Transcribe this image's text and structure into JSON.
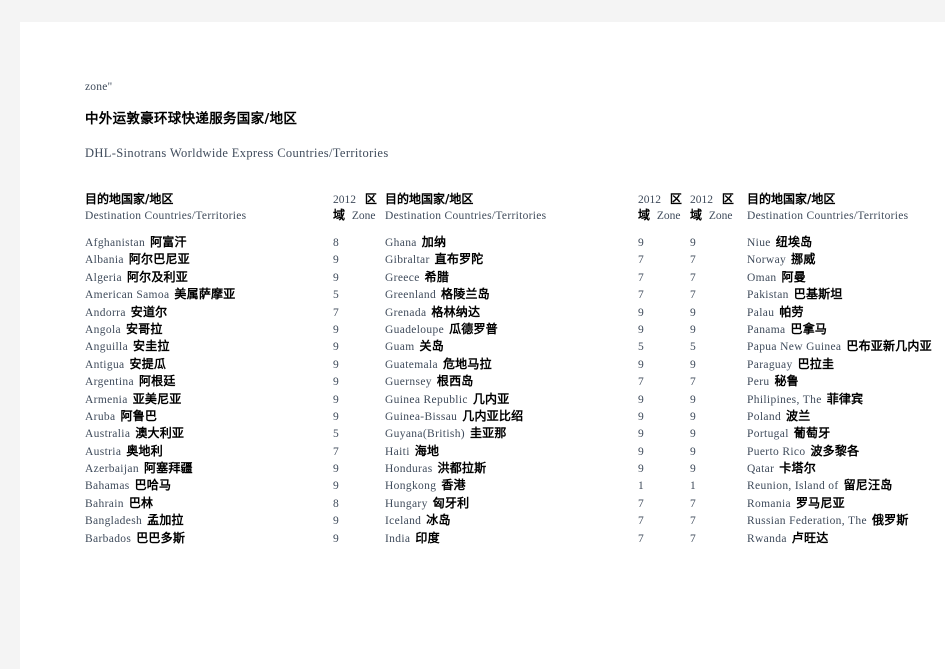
{
  "page": {
    "fragment_text": "zone\"",
    "title_cn": "中外运敦豪环球快递服务国家/地区",
    "title_en": "DHL-Sinotrans Worldwide Express Countries/Territories"
  },
  "colors": {
    "english_text": "#3f4b5b",
    "chinese_text": "#000000",
    "page_background": "#ffffff",
    "gutter": "#f4f4f4"
  },
  "header": {
    "destination_cn": "目的地国家/地区",
    "destination_en": "Destination Countries/Territories",
    "zone_year": "2012",
    "zone_cn_1": "区",
    "zone_cn_2": "域",
    "zone_en": "Zone"
  },
  "columns": [
    {
      "id": "column-1",
      "zone_position": "right",
      "rows": [
        {
          "en": "Afghanistan",
          "cn": "阿富汗",
          "zone": "8"
        },
        {
          "en": "Albania",
          "cn": "阿尔巴尼亚",
          "zone": "9"
        },
        {
          "en": "Algeria",
          "cn": "阿尔及利亚",
          "zone": "9"
        },
        {
          "en": "American Samoa",
          "cn": "美属萨摩亚",
          "zone": "5"
        },
        {
          "en": "Andorra",
          "cn": "安道尔",
          "zone": "7"
        },
        {
          "en": "Angola",
          "cn": "安哥拉",
          "zone": "9"
        },
        {
          "en": "Anguilla",
          "cn": "安圭拉",
          "zone": "9"
        },
        {
          "en": "Antigua",
          "cn": "安提瓜",
          "zone": "9"
        },
        {
          "en": "Argentina",
          "cn": "阿根廷",
          "zone": "9"
        },
        {
          "en": "Armenia",
          "cn": "亚美尼亚",
          "zone": "9"
        },
        {
          "en": "Aruba",
          "cn": "阿鲁巴",
          "zone": "9"
        },
        {
          "en": "Australia",
          "cn": "澳大利亚",
          "zone": "5"
        },
        {
          "en": "Austria",
          "cn": "奥地利",
          "zone": "7"
        },
        {
          "en": "Azerbaijan",
          "cn": "阿塞拜疆",
          "zone": "9"
        },
        {
          "en": "Bahamas",
          "cn": "巴哈马",
          "zone": "9"
        },
        {
          "en": "Bahrain",
          "cn": "巴林",
          "zone": "8"
        },
        {
          "en": "Bangladesh",
          "cn": "孟加拉",
          "zone": "9"
        },
        {
          "en": "Barbados",
          "cn": "巴巴多斯",
          "zone": "9"
        }
      ]
    },
    {
      "id": "column-2",
      "zone_position": "right",
      "rows": [
        {
          "en": "Ghana",
          "cn": "加纳",
          "zone": "9"
        },
        {
          "en": "Gibraltar",
          "cn": "直布罗陀",
          "zone": "7"
        },
        {
          "en": "Greece",
          "cn": "希腊",
          "zone": "7"
        },
        {
          "en": "Greenland",
          "cn": "格陵兰岛",
          "zone": "7"
        },
        {
          "en": "Grenada",
          "cn": "格林纳达",
          "zone": "9"
        },
        {
          "en": "Guadeloupe",
          "cn": "瓜德罗普",
          "zone": "9"
        },
        {
          "en": "Guam",
          "cn": "关岛",
          "zone": "5"
        },
        {
          "en": "Guatemala",
          "cn": "危地马拉",
          "zone": "9"
        },
        {
          "en": "Guernsey",
          "cn": "根西岛",
          "zone": "7"
        },
        {
          "en": "Guinea Republic",
          "cn": "几内亚",
          "zone": "9"
        },
        {
          "en": "Guinea-Bissau",
          "cn": "几内亚比绍",
          "zone": "9"
        },
        {
          "en": "Guyana(British)",
          "cn": "圭亚那",
          "zone": "9"
        },
        {
          "en": "Haiti",
          "cn": "海地",
          "zone": "9"
        },
        {
          "en": "Honduras",
          "cn": "洪都拉斯",
          "zone": "9"
        },
        {
          "en": "Hongkong",
          "cn": "香港",
          "zone": "1"
        },
        {
          "en": "Hungary",
          "cn": "匈牙利",
          "zone": "7"
        },
        {
          "en": "Iceland",
          "cn": "冰岛",
          "zone": "7"
        },
        {
          "en": "India",
          "cn": "印度",
          "zone": "7"
        }
      ]
    },
    {
      "id": "column-3",
      "zone_position": "left",
      "rows": [
        {
          "en": "Niue",
          "cn": "纽埃岛",
          "zone": "9"
        },
        {
          "en": "Norway",
          "cn": "挪威",
          "zone": "7"
        },
        {
          "en": "Oman",
          "cn": "阿曼",
          "zone": "7"
        },
        {
          "en": "Pakistan",
          "cn": "巴基斯坦",
          "zone": "7"
        },
        {
          "en": "Palau",
          "cn": "帕劳",
          "zone": "9"
        },
        {
          "en": "Panama",
          "cn": "巴拿马",
          "zone": "9"
        },
        {
          "en": "Papua New Guinea",
          "cn": "巴布亚新几内亚",
          "zone": "5"
        },
        {
          "en": "Paraguay",
          "cn": "巴拉圭",
          "zone": "9"
        },
        {
          "en": "Peru",
          "cn": "秘鲁",
          "zone": "7"
        },
        {
          "en": "Philipines, The",
          "cn": "菲律宾",
          "zone": "9"
        },
        {
          "en": "Poland",
          "cn": "波兰",
          "zone": "9"
        },
        {
          "en": "Portugal",
          "cn": "葡萄牙",
          "zone": "9"
        },
        {
          "en": "Puerto Rico",
          "cn": "波多黎各",
          "zone": "9"
        },
        {
          "en": "Qatar",
          "cn": "卡塔尔",
          "zone": "9"
        },
        {
          "en": "Reunion, Island of",
          "cn": "留尼汪岛",
          "zone": "1"
        },
        {
          "en": "Romania",
          "cn": "罗马尼亚",
          "zone": "7"
        },
        {
          "en": "Russian Federation, The",
          "cn": "俄罗斯",
          "zone": "7"
        },
        {
          "en": "Rwanda",
          "cn": "卢旺达",
          "zone": "7"
        }
      ]
    }
  ]
}
